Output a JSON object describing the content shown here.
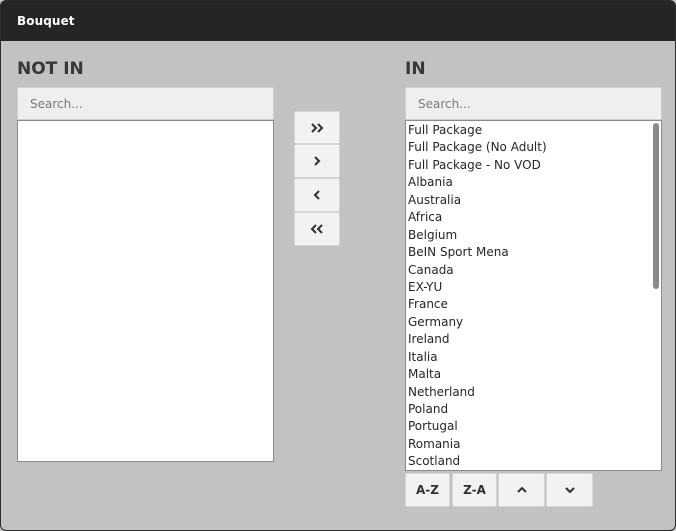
{
  "window": {
    "title": "Bouquet"
  },
  "not_in": {
    "heading": "NOT IN",
    "search_placeholder": "Search...",
    "items": []
  },
  "in": {
    "heading": "IN",
    "search_placeholder": "Search...",
    "items": [
      "Full Package",
      "Full Package (No Adult)",
      "Full Package - No VOD",
      "Albania",
      "Australia",
      "Africa",
      "Belgium",
      "BeIN Sport Mena",
      "Canada",
      "EX-YU",
      "France",
      "Germany",
      "Ireland",
      "Italia",
      "Malta",
      "Netherland",
      "Poland",
      "Portugal",
      "Romania",
      "Scotland"
    ]
  },
  "transfer_controls": {
    "move_all_right_icon": "double-chevron-right-icon",
    "move_right_icon": "chevron-right-icon",
    "move_left_icon": "chevron-left-icon",
    "move_all_left_icon": "double-chevron-left-icon"
  },
  "sort_controls": {
    "az_label": "A-Z",
    "za_label": "Z-A",
    "move_up_icon": "chevron-up-icon",
    "move_down_icon": "chevron-down-icon"
  },
  "colors": {
    "titlebar": "#252527",
    "background": "#c2c2c4",
    "button": "#f2f2f3",
    "list": "#ffffff"
  }
}
